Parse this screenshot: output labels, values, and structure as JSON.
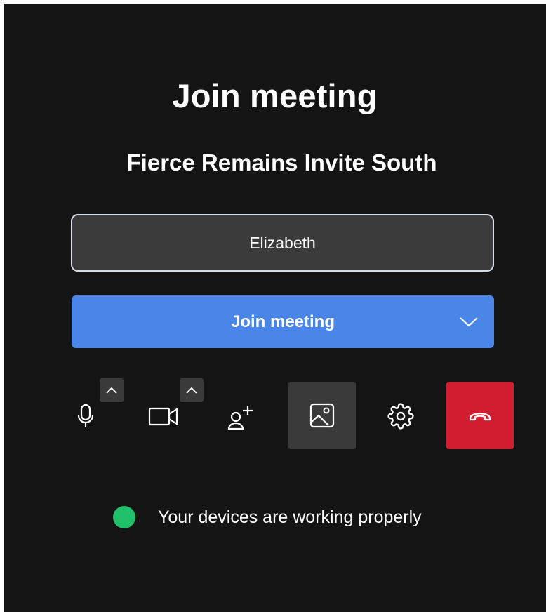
{
  "title": "Join meeting",
  "meeting_name": "Fierce Remains Invite South",
  "name_input": {
    "value": "Elizabeth",
    "placeholder": ""
  },
  "join_button": {
    "label": "Join meeting"
  },
  "controls": [
    {
      "name": "microphone",
      "icon": "microphone-icon",
      "has_options": true
    },
    {
      "name": "camera",
      "icon": "camera-icon",
      "has_options": true
    },
    {
      "name": "invite",
      "icon": "add-person-icon",
      "has_options": false
    },
    {
      "name": "background",
      "icon": "image-icon",
      "has_options": false
    },
    {
      "name": "settings",
      "icon": "gear-icon",
      "has_options": false
    },
    {
      "name": "leave",
      "icon": "hang-up-icon",
      "has_options": false
    }
  ],
  "status": {
    "text": "Your devices are working properly",
    "indicator_color": "#21c16b"
  },
  "colors": {
    "background": "#141414",
    "accent": "#4a86e8",
    "danger": "#d11f31",
    "field": "#3b3b3b"
  }
}
